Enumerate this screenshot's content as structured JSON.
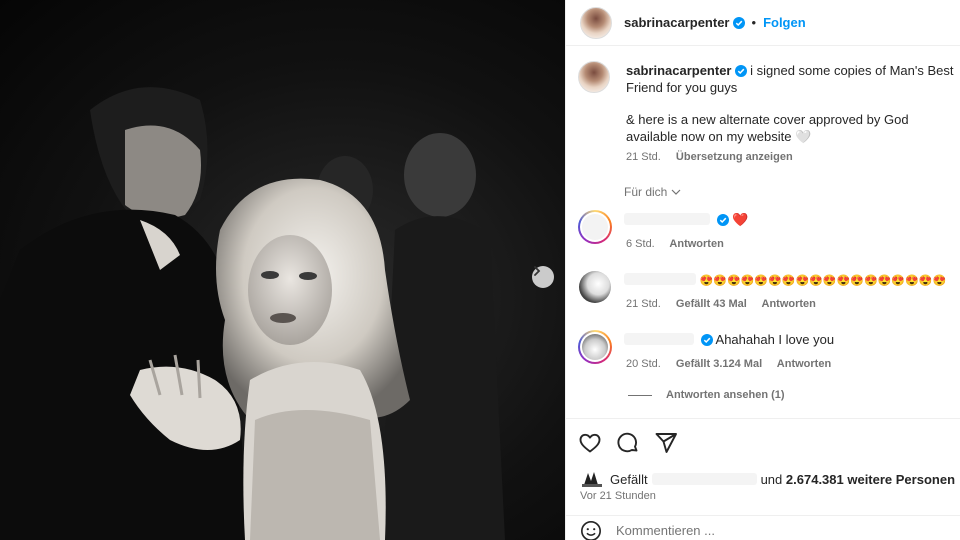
{
  "post": {
    "username": "sabrinacarpenter",
    "follow_label": "Folgen",
    "separator": "•",
    "caption_line1": "i signed some copies of Man's Best Friend for you guys",
    "caption_line2": "& here is a new alternate cover approved by God available now on my website 🤍",
    "caption_time": "21 Std.",
    "translate_label": "Übersetzung anzeigen"
  },
  "for_you_label": "Für dich",
  "comments": [
    {
      "text": "❤️",
      "time": "6 Std.",
      "likes": "",
      "reply": "Antworten"
    },
    {
      "text": "😍😍😍😍😍😍😍😍😍😍😍😍😍😍😍😍😍😍",
      "time": "21 Std.",
      "likes": "Gefällt 43 Mal",
      "reply": "Antworten"
    },
    {
      "text": "Ahahahah I love you",
      "time": "20 Std.",
      "likes": "Gefällt 3.124 Mal",
      "reply": "Antworten"
    }
  ],
  "view_replies_label": "Antworten ansehen (1)",
  "likes": {
    "prefix": "Gefällt",
    "and_text": "und",
    "count_text": "2.674.381 weitere Personen"
  },
  "timestamp": "Vor 21 Stunden",
  "comment_input_placeholder": "Kommentieren ...",
  "icons": {
    "next": "chevron-right-icon",
    "like": "heart-icon",
    "comment": "speech-bubble-icon",
    "share": "paper-plane-icon",
    "emoji": "smiley-icon",
    "verified": "verified-badge-icon"
  },
  "colors": {
    "accent": "#0095f6",
    "text": "#262626",
    "muted": "#737373"
  }
}
